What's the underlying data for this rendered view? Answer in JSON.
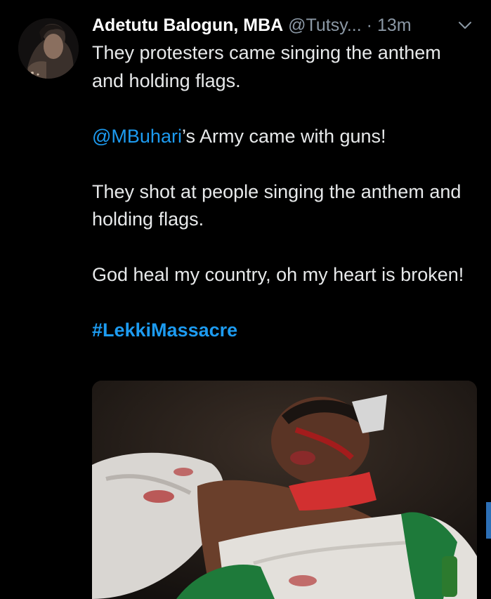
{
  "tweet": {
    "author": {
      "display_name": "Adetutu Balogun, MBA",
      "handle": "@Tutsy...",
      "avatar_icon": "profile-photo"
    },
    "separator": "·",
    "time": "13m",
    "menu_icon": "chevron-down-icon",
    "text": {
      "line1": "They protesters came singing the anthem and holding flags.",
      "mention": "@MBuhari",
      "line2_rest": "’s Army came with guns!",
      "line3": "They shot at people singing the anthem and holding flags.",
      "line4": "God heal my country, oh my heart is broken!",
      "hashtag": "#LekkiMassacre"
    },
    "media": {
      "kind": "photo"
    }
  },
  "colors": {
    "background": "#000000",
    "text": "#e7e9ea",
    "secondary": "#8b98a5",
    "link": "#1d9bf0"
  }
}
